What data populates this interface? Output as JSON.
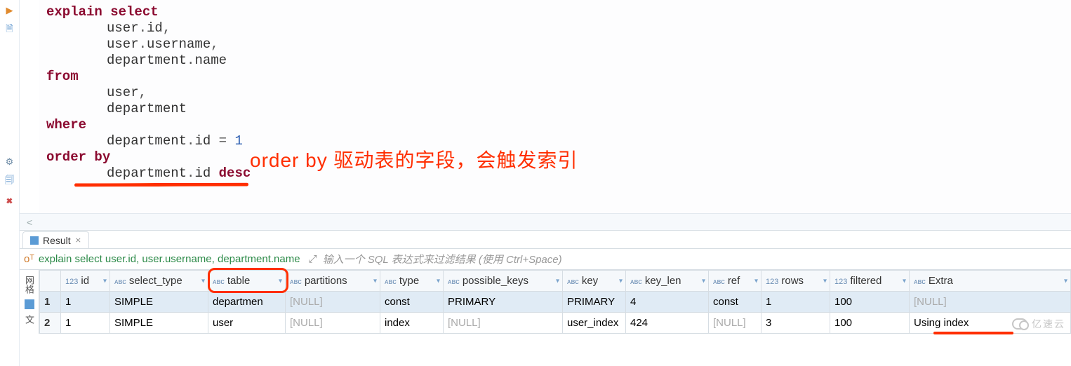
{
  "sql": {
    "line1": {
      "kw": "explain select"
    },
    "line2": {
      "tbl": "user",
      "dot": ".",
      "col": "id",
      "comma": ","
    },
    "line3": {
      "tbl": "user",
      "dot": ".",
      "col": "username",
      "comma": ","
    },
    "line4": {
      "tbl": "department",
      "dot": ".",
      "col": "name"
    },
    "line5": {
      "kw": "from"
    },
    "line6": {
      "tbl": "user",
      "comma": ","
    },
    "line7": {
      "tbl": "department"
    },
    "line8": {
      "kw": "where"
    },
    "line9": {
      "tbl": "department",
      "dot": ".",
      "col": "id",
      "op": " = ",
      "val": "1"
    },
    "line10": {
      "kw": "order by"
    },
    "line11": {
      "tbl": "department",
      "dot": ".",
      "col": "id ",
      "kw": "desc"
    }
  },
  "annotation_text": "order by 驱动表的字段，会触发索引",
  "scrollbar_hint": "<",
  "result_tab": {
    "label": "Result",
    "close": "⨯"
  },
  "filter": {
    "sql_text": "explain select user.id, user.username, department.name",
    "placeholder": "输入一个 SQL 表达式来过滤结果 (使用 Ctrl+Space)"
  },
  "columns": {
    "id": "id",
    "select_type": "select_type",
    "table": "table",
    "partitions": "partitions",
    "type": "type",
    "possible_keys": "possible_keys",
    "key": "key",
    "key_len": "key_len",
    "ref": "ref",
    "rows": "rows",
    "filtered": "filtered",
    "Extra": "Extra"
  },
  "col_type_icons": {
    "num": "123",
    "txt": "ᴀʙᴄ"
  },
  "rows": [
    {
      "n": "1",
      "id": "1",
      "select_type": "SIMPLE",
      "table": "departmen",
      "partitions": "[NULL]",
      "type": "const",
      "possible_keys": "PRIMARY",
      "key": "PRIMARY",
      "key_len": "4",
      "ref": "const",
      "rows": "1",
      "filtered": "100",
      "Extra": "[NULL]"
    },
    {
      "n": "2",
      "id": "1",
      "select_type": "SIMPLE",
      "table": "user",
      "partitions": "[NULL]",
      "type": "index",
      "possible_keys": "[NULL]",
      "key": "user_index",
      "key_len": "424",
      "ref": "[NULL]",
      "rows": "3",
      "filtered": "100",
      "Extra": "Using index"
    }
  ],
  "side_tabs": {
    "grid": "网格",
    "text": "文"
  },
  "watermark": "亿速云"
}
